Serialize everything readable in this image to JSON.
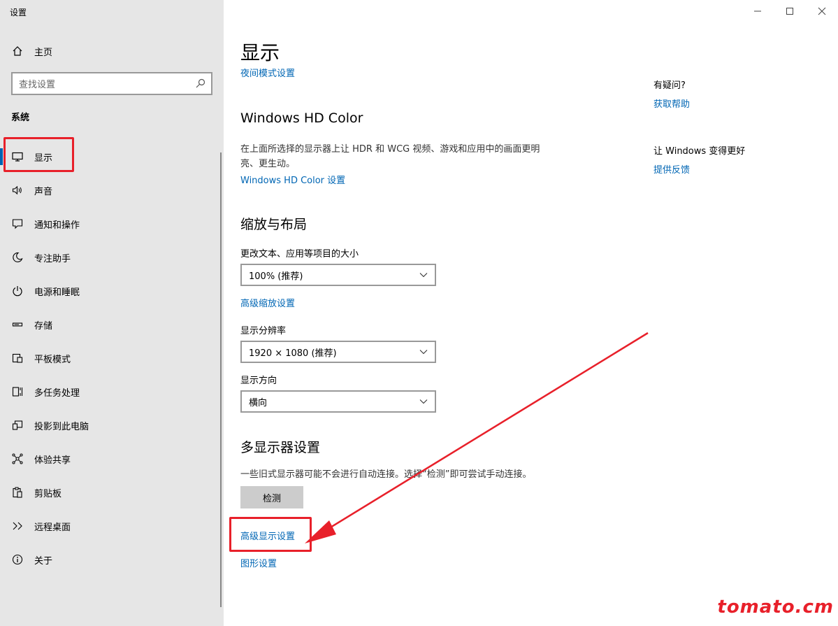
{
  "window": {
    "title": "设置"
  },
  "sidebar": {
    "home_label": "主页",
    "search_placeholder": "查找设置",
    "group_label": "系统",
    "items": [
      {
        "label": "显示",
        "icon": "monitor-icon"
      },
      {
        "label": "声音",
        "icon": "speaker-icon"
      },
      {
        "label": "通知和操作",
        "icon": "notification-icon"
      },
      {
        "label": "专注助手",
        "icon": "moon-icon"
      },
      {
        "label": "电源和睡眠",
        "icon": "power-icon"
      },
      {
        "label": "存储",
        "icon": "storage-icon"
      },
      {
        "label": "平板模式",
        "icon": "tablet-icon"
      },
      {
        "label": "多任务处理",
        "icon": "multitask-icon"
      },
      {
        "label": "投影到此电脑",
        "icon": "project-icon"
      },
      {
        "label": "体验共享",
        "icon": "share-icon"
      },
      {
        "label": "剪贴板",
        "icon": "clipboard-icon"
      },
      {
        "label": "远程桌面",
        "icon": "remote-desktop-icon"
      },
      {
        "label": "关于",
        "icon": "info-icon"
      }
    ],
    "selected": "显示"
  },
  "main": {
    "title": "显示",
    "night_light_link": "夜间模式设置",
    "hdr": {
      "heading": "Windows HD Color",
      "description": "在上面所选择的显示器上让 HDR 和 WCG 视频、游戏和应用中的画面更明亮、更生动。",
      "link": "Windows HD Color 设置"
    },
    "scale": {
      "heading": "缩放与布局",
      "size_label": "更改文本、应用等项目的大小",
      "size_value": "100% (推荐)",
      "advanced_scaling_link": "高级缩放设置",
      "resolution_label": "显示分辨率",
      "resolution_value": "1920 × 1080 (推荐)",
      "orientation_label": "显示方向",
      "orientation_value": "横向"
    },
    "multi": {
      "heading": "多显示器设置",
      "description": "一些旧式显示器可能不会进行自动连接。选择“检测”即可尝试手动连接。",
      "detect_button": "检测",
      "advanced_display_link": "高级显示设置",
      "graphics_link": "图形设置"
    }
  },
  "right_panel": {
    "question": "有疑问?",
    "help_link": "获取帮助",
    "improve": "让 Windows 变得更好",
    "feedback_link": "提供反馈"
  },
  "watermark": "tomato.cm",
  "colors": {
    "accent": "#0063b1",
    "link": "#0066b4",
    "annotation": "#e8202a",
    "sidebar_bg": "#e6e6e6"
  }
}
